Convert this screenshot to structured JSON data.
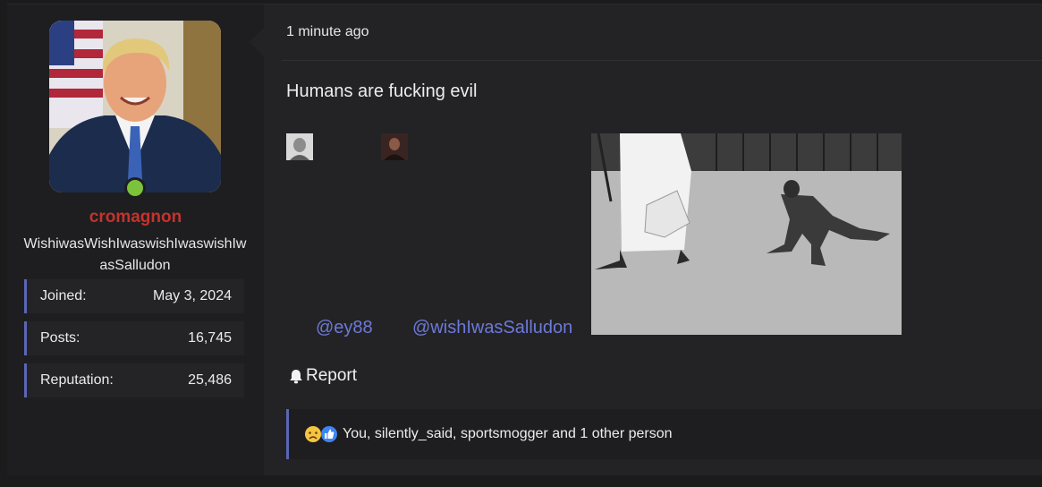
{
  "post": {
    "time": "1 minute ago",
    "message": "Humans are fucking evil",
    "mentions": [
      "@ey88",
      "@wishIwasSalludon"
    ],
    "report_label": "Report",
    "reactions_text": "You, silently_said, sportsmogger and 1 other person"
  },
  "user": {
    "username": "cromagnon",
    "title": "WishiwasWishIwaswishIwaswishIwasSalludon",
    "stats": [
      {
        "label": "Joined:",
        "value": "May 3, 2024"
      },
      {
        "label": "Posts:",
        "value": "16,745"
      },
      {
        "label": "Reputation:",
        "value": "25,486"
      }
    ]
  },
  "colors": {
    "username": "#c6322b",
    "accent": "#5b66b4",
    "mention": "#6c79d9",
    "online": "#7cc33b"
  },
  "icons": {
    "report": "bell-icon",
    "reaction_sad": "sad-face-icon",
    "reaction_like": "thumbs-up-icon"
  }
}
